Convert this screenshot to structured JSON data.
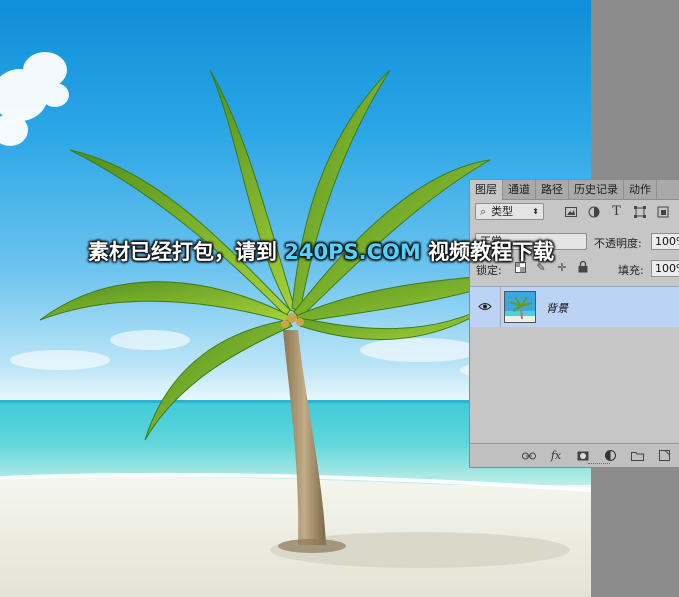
{
  "banner": {
    "text_before": "素材已经打包，请到 ",
    "highlight": "240PS.COM",
    "text_after": " 视频教程下载"
  },
  "layers_panel": {
    "tabs": [
      {
        "label": "图层"
      },
      {
        "label": "通道"
      },
      {
        "label": "路径"
      },
      {
        "label": "历史记录"
      },
      {
        "label": "动作"
      }
    ],
    "filter": {
      "label": "类型",
      "icon": "search-icon"
    },
    "blend_mode": "正常",
    "opacity_label": "不透明度:",
    "opacity_value": "100%",
    "lock_label": "锁定:",
    "fill_label": "填充:",
    "fill_value": "100%",
    "layers": [
      {
        "name": "背景",
        "visible": true,
        "selected": true
      }
    ],
    "bottom_icons": [
      "link-icon",
      "fx-icon",
      "mask-icon",
      "adjustment-icon",
      "folder-icon",
      "new-layer-icon"
    ]
  },
  "colors": {
    "selected_layer": "#bcd3f5",
    "panel_bg": "#c6c6c6",
    "banner_highlight": "#4fd3ff"
  }
}
